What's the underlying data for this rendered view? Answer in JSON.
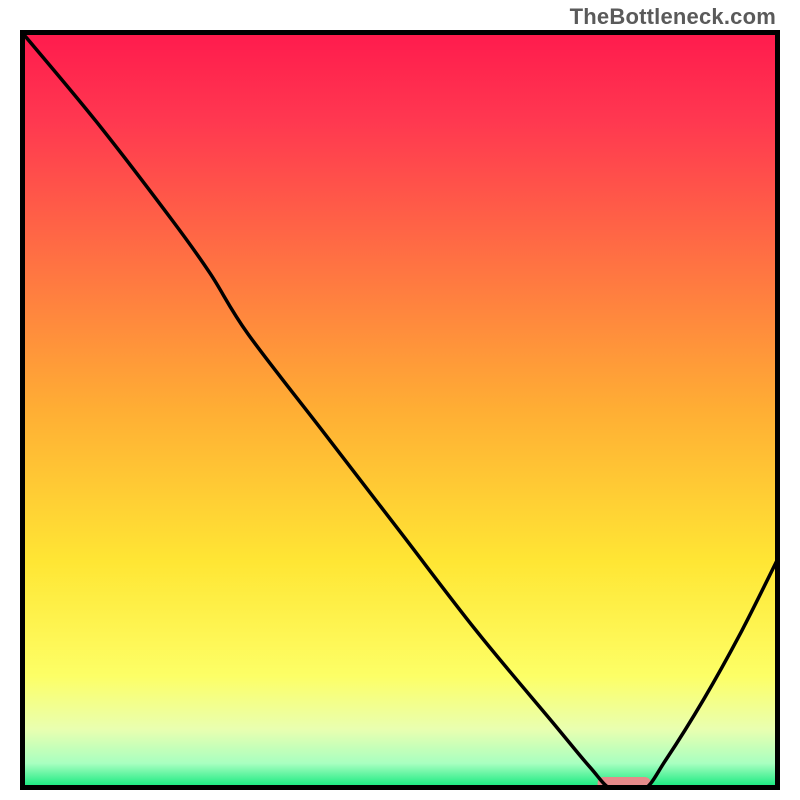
{
  "watermark": "TheBottleneck.com",
  "chart_data": {
    "type": "line",
    "title": "",
    "xlabel": "",
    "ylabel": "",
    "xlim": [
      0,
      100
    ],
    "ylim": [
      0,
      100
    ],
    "grid": false,
    "legend": false,
    "annotations": [],
    "series": [
      {
        "name": "bottleneck-curve",
        "x": [
          0,
          10,
          20,
          25,
          30,
          40,
          50,
          60,
          70,
          75,
          78,
          82,
          85,
          90,
          95,
          100
        ],
        "values": [
          100,
          88,
          75,
          68,
          60,
          47,
          34,
          21,
          9,
          3,
          0,
          0,
          4,
          12,
          21,
          31
        ]
      }
    ],
    "optimum_marker": {
      "x_start": 76,
      "x_end": 83,
      "y": 0,
      "color": "#e58a8a"
    },
    "background_gradient": {
      "stops": [
        {
          "offset": 0.0,
          "color": "#ff1a4d"
        },
        {
          "offset": 0.12,
          "color": "#ff3850"
        },
        {
          "offset": 0.3,
          "color": "#ff7043"
        },
        {
          "offset": 0.5,
          "color": "#ffae34"
        },
        {
          "offset": 0.7,
          "color": "#ffe634"
        },
        {
          "offset": 0.85,
          "color": "#fdff66"
        },
        {
          "offset": 0.92,
          "color": "#e9ffb0"
        },
        {
          "offset": 0.965,
          "color": "#a8ffc0"
        },
        {
          "offset": 1.0,
          "color": "#00e676"
        }
      ]
    }
  }
}
